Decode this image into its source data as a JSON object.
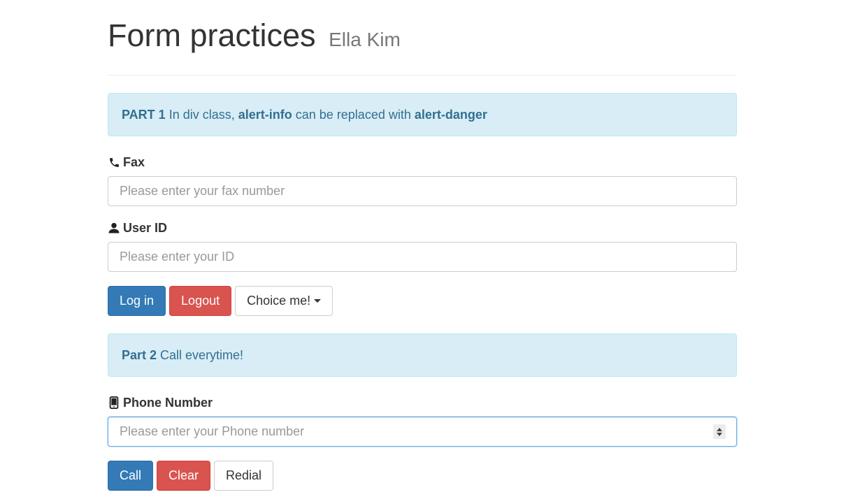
{
  "header": {
    "title": "Form practices",
    "subtitle": "Ella Kim"
  },
  "alert1": {
    "strong": "PART 1",
    "text1": " In div class, ",
    "bold1": "alert-info",
    "text2": " can be replaced with ",
    "bold2": "alert-danger"
  },
  "fax": {
    "label": "Fax",
    "placeholder": "Please enter your fax number",
    "icon": "phone-icon"
  },
  "user_id": {
    "label": "User ID",
    "placeholder": "Please enter your ID",
    "icon": "user-icon"
  },
  "buttons1": {
    "login": "Log in",
    "logout": "Logout",
    "choice": "Choice me!"
  },
  "alert2": {
    "strong": "Part 2",
    "text": " Call everytime!"
  },
  "phone": {
    "label": "Phone Number",
    "placeholder": "Please enter your Phone number",
    "icon": "mobile-phone-icon"
  },
  "buttons2": {
    "call": "Call",
    "clear": "Clear",
    "redial": "Redial"
  },
  "colors": {
    "primary": "#337ab7",
    "danger": "#d9534f",
    "alert_bg": "#d9edf7",
    "alert_text": "#31708f"
  }
}
